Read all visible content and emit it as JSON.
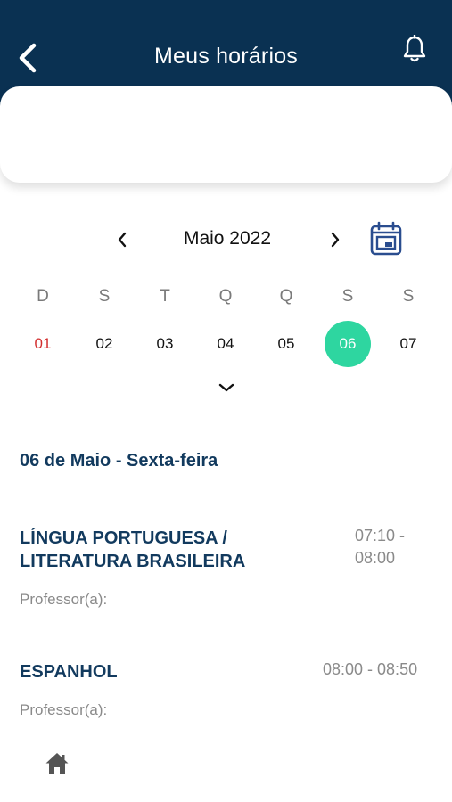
{
  "header": {
    "title": "Meus horários"
  },
  "calendar": {
    "month_label": "Maio 2022",
    "weekdays": [
      "D",
      "S",
      "T",
      "Q",
      "Q",
      "S",
      "S"
    ],
    "days": [
      "01",
      "02",
      "03",
      "04",
      "05",
      "06",
      "07"
    ],
    "selected_day": "06"
  },
  "schedule": {
    "date_heading": "06 de Maio - Sexta-feira",
    "entries": [
      {
        "subject_line1": "LÍNGUA PORTUGUESA /",
        "subject_line2": "LITERATURA BRASILEIRA",
        "time_line1": "07:10 -",
        "time_line2": "08:00",
        "professor_label": "Professor(a):"
      },
      {
        "subject_line1": "ESPANHOL",
        "time_line1": "08:00 - 08:50",
        "professor_label": "Professor(a):"
      }
    ]
  },
  "colors": {
    "header_bg": "#0a3152",
    "accent": "#2ed6a0",
    "heading": "#123a5e",
    "sunday": "#d32f2f"
  },
  "icons": [
    "back-arrow-icon",
    "bell-icon",
    "chevron-left-icon",
    "chevron-right-icon",
    "calendar-icon",
    "chevron-down-icon",
    "home-icon"
  ]
}
